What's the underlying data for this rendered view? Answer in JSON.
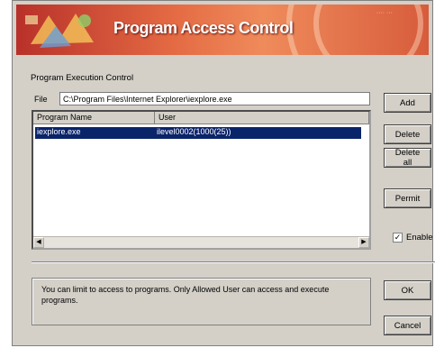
{
  "banner": {
    "title": "Program Access Control",
    "corner_text": "···· ···"
  },
  "group": {
    "label": "Program Execution Control"
  },
  "file": {
    "label": "File",
    "value": "C:\\Program Files\\Internet Explorer\\iexplore.exe"
  },
  "list": {
    "columns": [
      "Program Name",
      "User"
    ],
    "rows": [
      {
        "name": "iexplore.exe",
        "user": "ilevel0002(1000(25))"
      }
    ]
  },
  "buttons": {
    "add": "Add",
    "delete": "Delete",
    "delete_all": "Delete all",
    "permit": "Permit",
    "ok": "OK",
    "cancel": "Cancel"
  },
  "enable": {
    "label": "Enable",
    "checked": true
  },
  "info": {
    "text": "You can limit to access to programs. Only Allowed User can access and execute programs."
  },
  "colors": {
    "selection": "#0a246a",
    "dialog_bg": "#d4d0c8",
    "banner": "#e46a43"
  }
}
